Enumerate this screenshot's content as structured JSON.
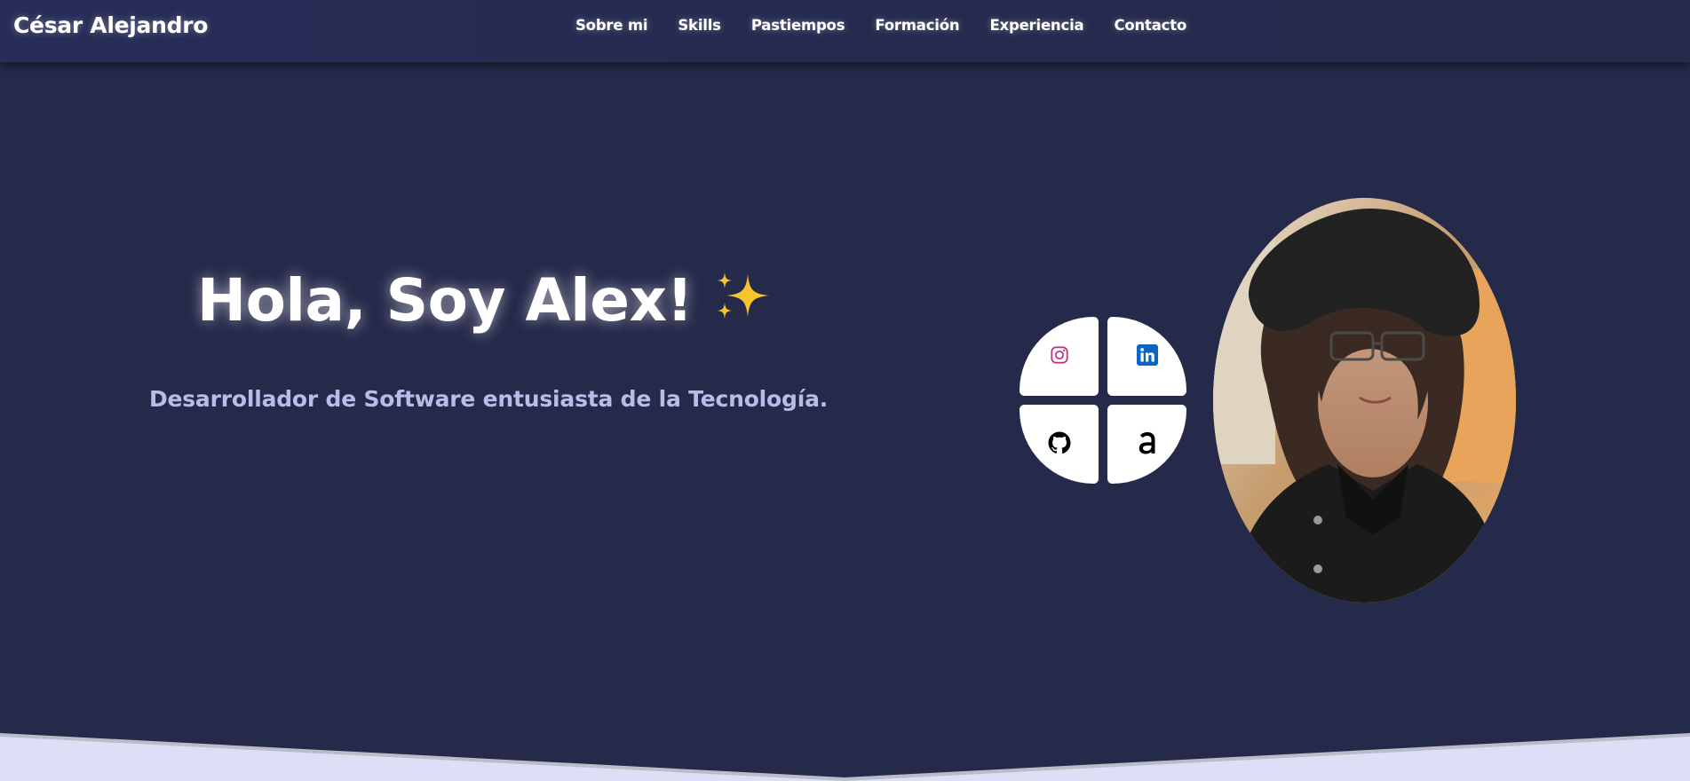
{
  "header": {
    "brand": "César Alejandro",
    "nav": [
      "Sobre mi",
      "Skills",
      "Pastiempos",
      "Formación",
      "Experiencia",
      "Contacto"
    ]
  },
  "hero": {
    "title": "Hola, Soy Alex!",
    "subtitle": "Desarrollador de Software entusiasta de la Tecnología."
  },
  "social": [
    {
      "icon": "instagram-icon",
      "color": "#c13584"
    },
    {
      "icon": "linkedin-icon",
      "color": "#0a66c2"
    },
    {
      "icon": "github-icon",
      "color": "#000000"
    },
    {
      "icon": "anilist-icon",
      "color": "#000000"
    }
  ],
  "colors": {
    "background": "#252a4a",
    "navbar": "#272d58",
    "subtitle": "#b7bde8",
    "footer_wave": "#dcdff5"
  }
}
